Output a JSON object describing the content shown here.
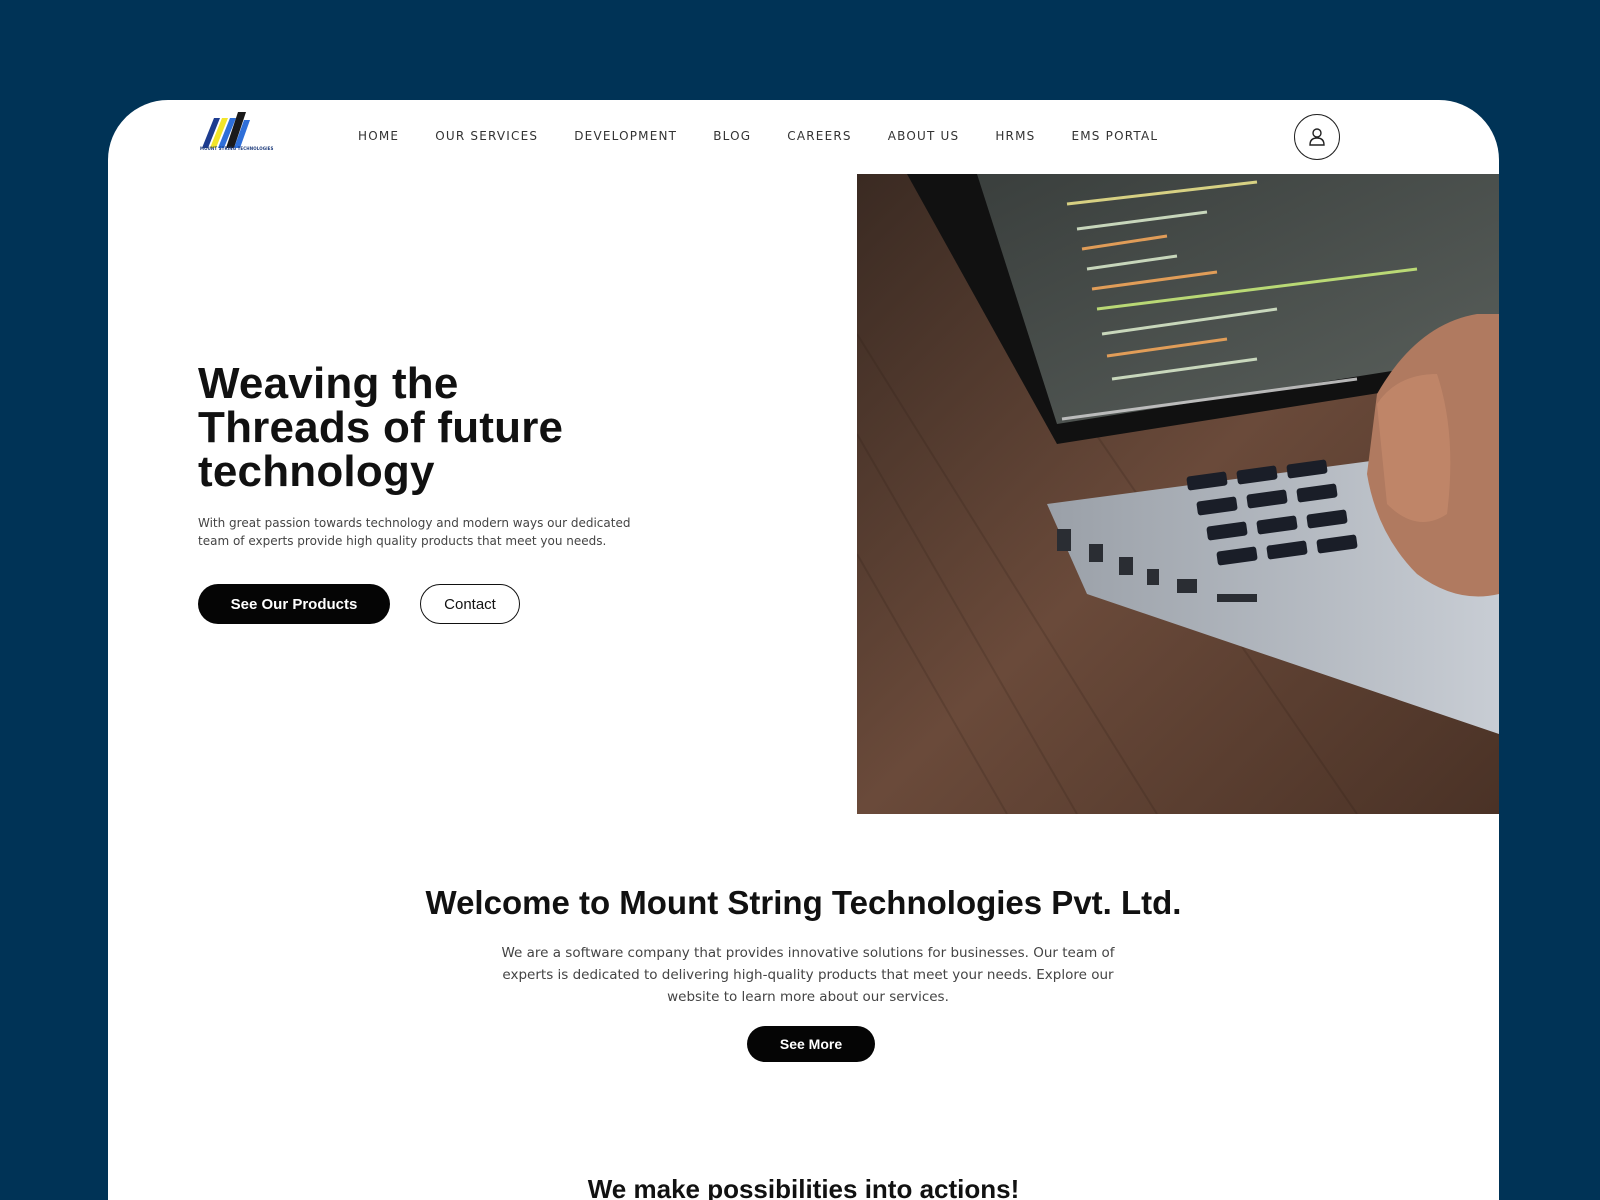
{
  "brand": {
    "logo_text": "MOUNT STRING TECHNOLOGIES",
    "logo_colors": [
      "#1d3c8f",
      "#2e6fd9",
      "#f2e52a",
      "#1a1a1a"
    ]
  },
  "nav": {
    "items": [
      {
        "label": "HOME"
      },
      {
        "label": "OUR SERVICES"
      },
      {
        "label": "DEVELOPMENT"
      },
      {
        "label": "BLOG"
      },
      {
        "label": "CAREERS"
      },
      {
        "label": "ABOUT US"
      },
      {
        "label": "HRMS"
      },
      {
        "label": "EMS PORTAL"
      }
    ],
    "user_icon": "user-icon"
  },
  "hero": {
    "title_line1": "Weaving the",
    "title_line2": "Threads of future",
    "title_line3": "technology",
    "description": "With great passion towards technology and modern ways our dedicated team of experts provide high quality products that meet you needs.",
    "primary_button": "See Our Products",
    "secondary_button": "Contact",
    "image_alt": "laptop-code-photo"
  },
  "welcome": {
    "title": "Welcome to Mount String Technologies Pvt. Ltd.",
    "description": "We are a software company that provides innovative solutions for businesses. Our team of experts is dedicated to delivering high-quality products that meet your needs. Explore our website to learn more about our services.",
    "button": "See More"
  },
  "next_section": {
    "title": "We make possibilities into actions!"
  },
  "colors": {
    "background": "#003356",
    "page": "#ffffff",
    "button_dark": "#050505",
    "text": "#111111"
  }
}
